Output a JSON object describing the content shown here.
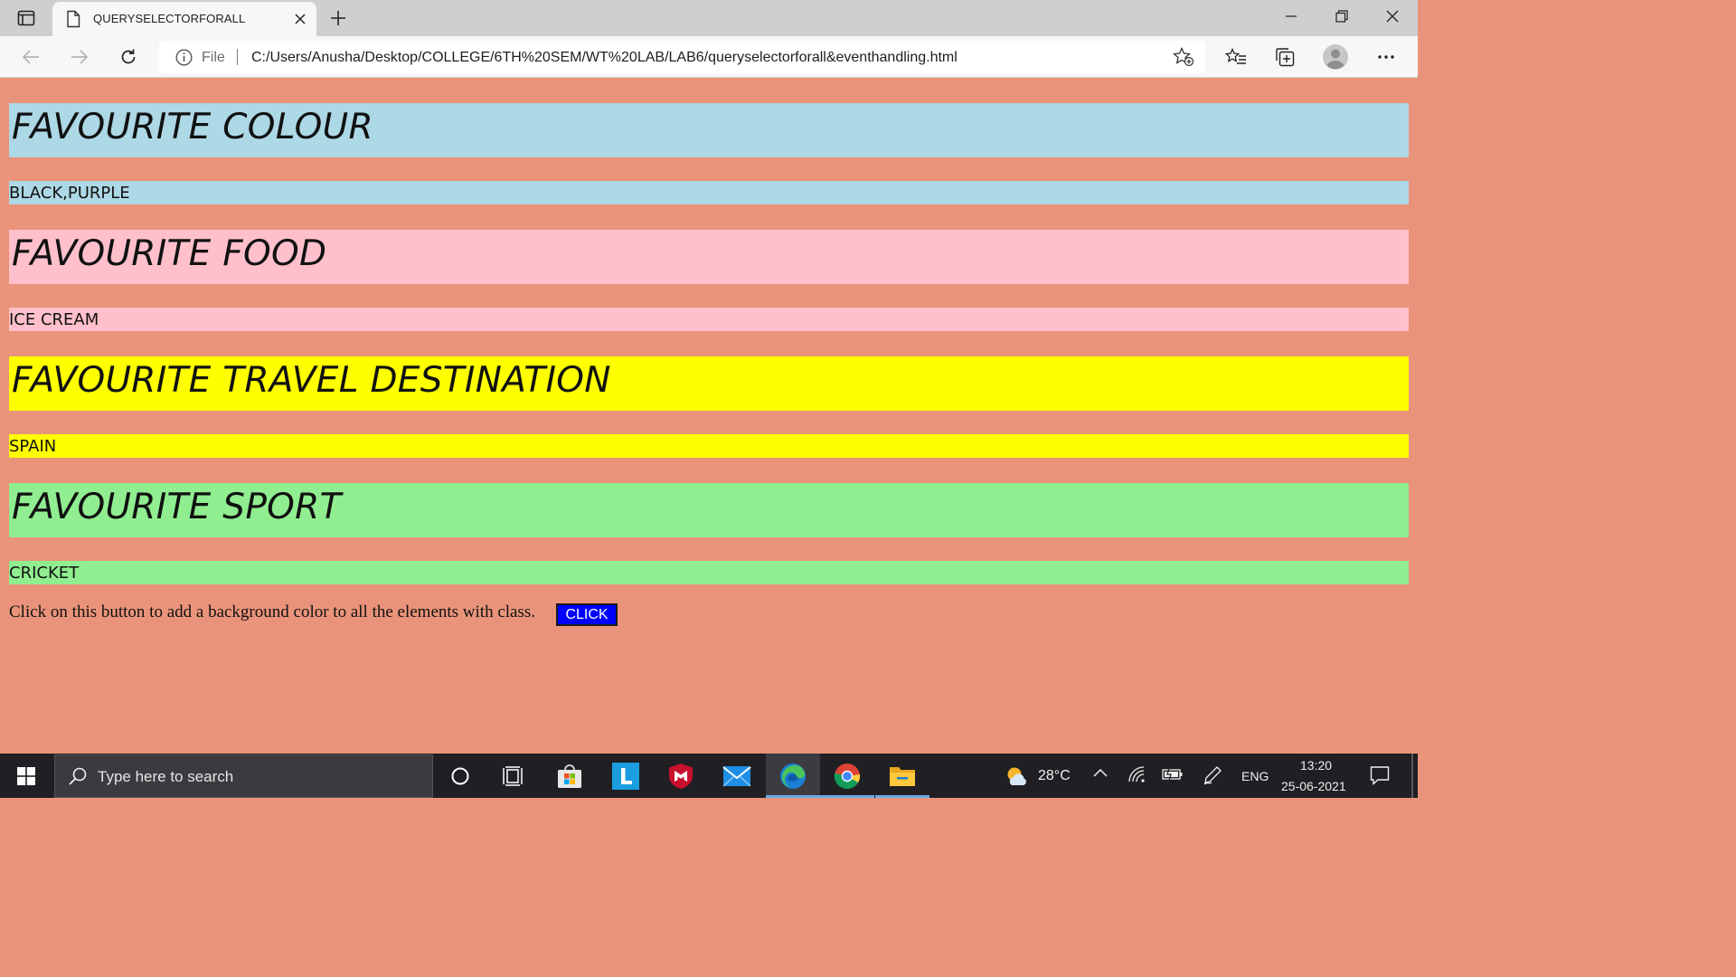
{
  "browser": {
    "tab": {
      "title": "QUERYSELECTORFORALL"
    },
    "address": {
      "scheme_label": "File",
      "url": "C:/Users/Anusha/Desktop/COLLEGE/6TH%20SEM/WT%20LAB/LAB6/queryselectorforall&eventhandling.html"
    }
  },
  "page": {
    "sections": [
      {
        "heading": "FAVOURITE COLOUR",
        "value": "BLACK,PURPLE",
        "color": "#add8e6"
      },
      {
        "heading": "FAVOURITE FOOD",
        "value": "ICE CREAM",
        "color": "#ffc0cb"
      },
      {
        "heading": "FAVOURITE TRAVEL DESTINATION",
        "value": "SPAIN",
        "color": "#ffff00"
      },
      {
        "heading": "FAVOURITE SPORT",
        "value": "CRICKET",
        "color": "#90ee90"
      }
    ],
    "instruction": "Click on this button to add a background color to all the elements with class.",
    "button_label": "CLICK",
    "background": "#e9947a",
    "button_color": "#0000ff"
  },
  "taskbar": {
    "search_placeholder": "Type here to search",
    "apps": [
      "cortana-icon",
      "task-view-icon",
      "store-icon",
      "l-app-icon",
      "mcafee-icon",
      "mail-icon",
      "edge-icon",
      "chrome-icon",
      "file-explorer-icon"
    ],
    "active_app": "edge-icon",
    "weather_temp": "28°C",
    "language": "ENG",
    "time": "13:20",
    "date": "25-06-2021"
  }
}
